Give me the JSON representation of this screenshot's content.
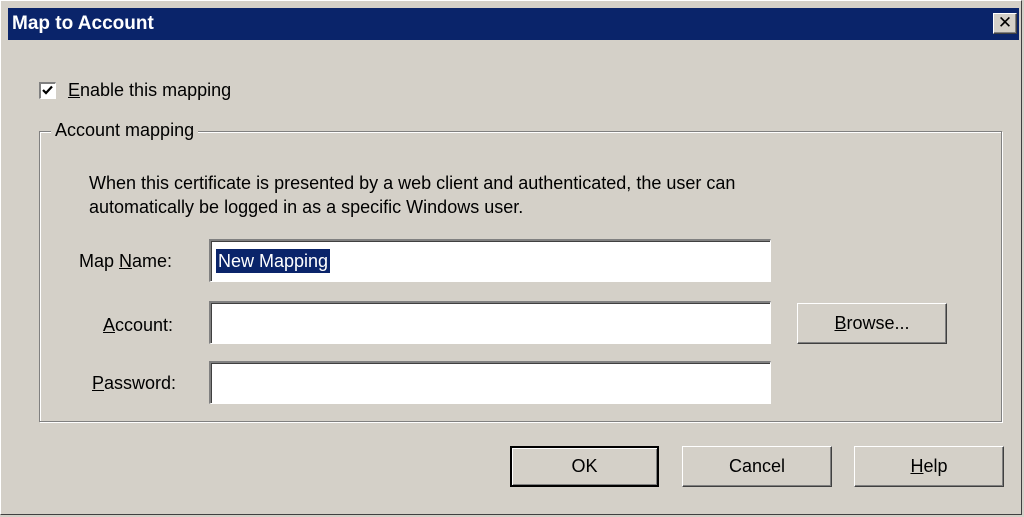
{
  "window": {
    "title": "Map to Account",
    "close_glyph": "✕"
  },
  "enable_checkbox": {
    "checked": true,
    "label_mnemonic": "E",
    "label_rest": "nable this mapping"
  },
  "group": {
    "legend": "Account mapping",
    "description_line1": "When this certificate is presented by a web client and authenticated, the user can",
    "description_line2": "automatically be logged in as a specific Windows user."
  },
  "fields": {
    "map_name": {
      "label_prefix": "Map ",
      "label_mnemonic": "N",
      "label_rest": "ame:",
      "value": "New Mapping"
    },
    "account": {
      "label_mnemonic": "A",
      "label_rest": "ccount:",
      "value": ""
    },
    "password": {
      "label_mnemonic": "P",
      "label_rest": "assword:",
      "value": ""
    }
  },
  "buttons": {
    "browse_mnemonic": "B",
    "browse_rest": "rowse...",
    "ok": "OK",
    "cancel": "Cancel",
    "help_mnemonic": "H",
    "help_rest": "elp"
  },
  "icons": {
    "checkbox_check": "check-icon",
    "close": "close-icon"
  }
}
